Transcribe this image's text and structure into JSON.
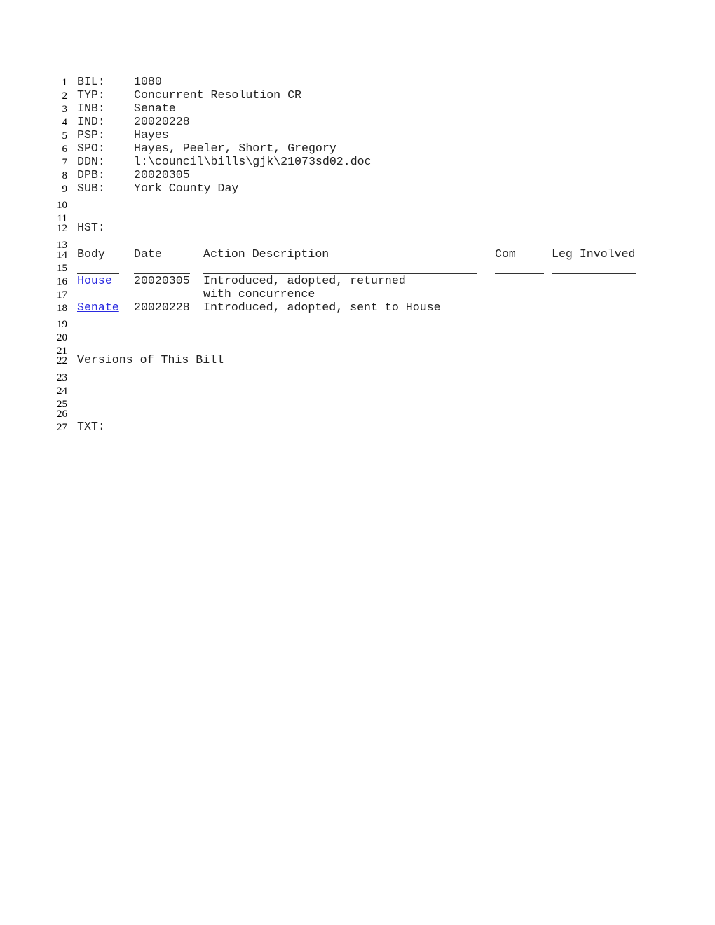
{
  "line_numbers": [
    "1",
    "2",
    "3",
    "4",
    "5",
    "6",
    "7",
    "8",
    "9",
    "10",
    "11",
    "12",
    "13",
    "14",
    "15",
    "16",
    "17",
    "18",
    "19",
    "20",
    "21",
    "22",
    "23",
    "24",
    "25",
    "26",
    "27"
  ],
  "fields": [
    {
      "key": "BIL:",
      "value": "1080"
    },
    {
      "key": "TYP:",
      "value": "Concurrent Resolution CR"
    },
    {
      "key": "INB:",
      "value": "Senate"
    },
    {
      "key": "IND:",
      "value": "20020228"
    },
    {
      "key": "PSP:",
      "value": "Hayes"
    },
    {
      "key": "SPO:",
      "value": "Hayes, Peeler, Short, Gregory"
    },
    {
      "key": "DDN:",
      "value": "l:\\council\\bills\\gjk\\21073sd02.doc"
    },
    {
      "key": "DPB:",
      "value": "20020305"
    },
    {
      "key": "SUB:",
      "value": "York County Day"
    }
  ],
  "history": {
    "label": "HST:",
    "headers": {
      "body": "Body",
      "date": "Date",
      "action": "Action Description",
      "com": "Com",
      "leg": "Leg Involved"
    },
    "rows": [
      {
        "body": "House",
        "date": "20020305",
        "action": "Introduced, adopted, returned",
        "action_cont": "with concurrence"
      },
      {
        "body": "Senate",
        "date": "20020228",
        "action": "Introduced, adopted, sent to House"
      }
    ]
  },
  "versions_label": "Versions of This Bill",
  "txt_label": "TXT:",
  "colors": {
    "link": "#2a2ae0",
    "text": "#222222"
  }
}
